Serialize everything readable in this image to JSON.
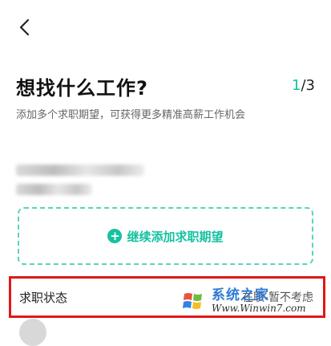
{
  "header": {
    "title": "想找什么工作?",
    "step_current": "1",
    "step_sep": "/",
    "step_total": "3",
    "subtitle": "添加多个求职期望，可获得更多精准高薪工作机会"
  },
  "add_expectation": {
    "label": "继续添加求职期望"
  },
  "status_row": {
    "label": "求职状态",
    "value": "在职-暂不考虑"
  },
  "watermark": {
    "name": "系统之家",
    "url": "Www.Winwin7.com"
  },
  "colors": {
    "accent": "#15c2a0",
    "highlight_border": "#e01818"
  },
  "icons": {
    "back": "chevron-left-icon",
    "add": "plus-circle-icon"
  }
}
